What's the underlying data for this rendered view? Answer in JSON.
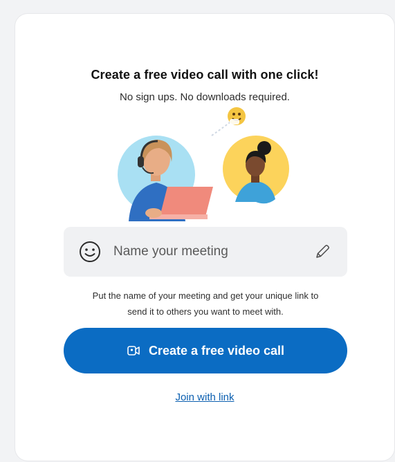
{
  "card": {
    "title": "Create a free video call with one click!",
    "subtitle": "No sign ups. No downloads required."
  },
  "meeting_field": {
    "placeholder": "Name your meeting",
    "value": "",
    "leading_icon": "smiley-icon",
    "trailing_icon": "pencil-icon"
  },
  "helper_text": {
    "line1": "Put the name of your meeting and get your unique link to",
    "line2": "send it to others you want to meet with."
  },
  "cta": {
    "label": "Create a free video call",
    "icon": "video-call-icon"
  },
  "join_link": {
    "label": "Join with link"
  },
  "colors": {
    "primary": "#0b6cc3",
    "link": "#0b5fb0",
    "field_bg": "#f0f1f3"
  }
}
